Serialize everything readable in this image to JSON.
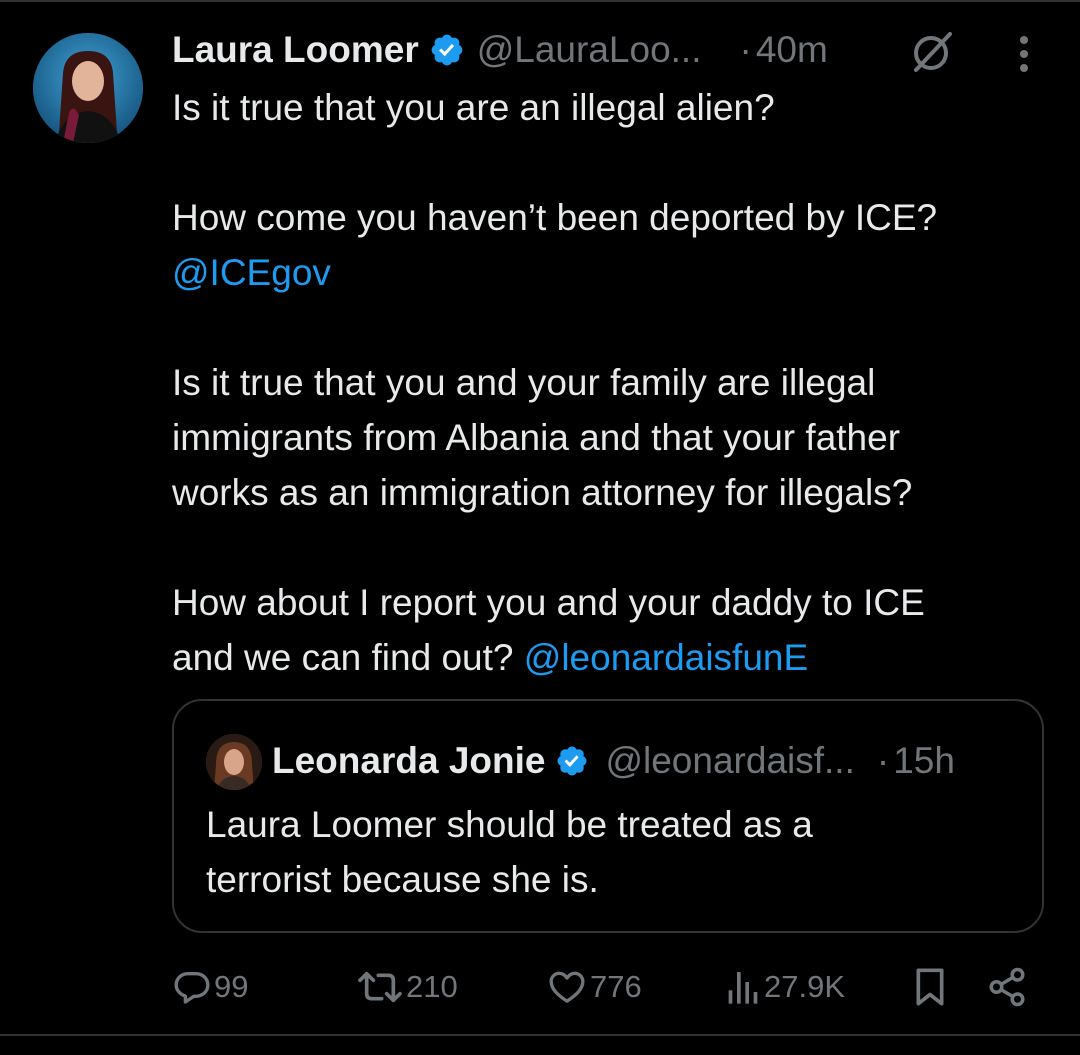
{
  "tweet": {
    "author_name": "Laura Loomer",
    "author_handle": "@LauraLoo...",
    "time_separator": "·",
    "time": "40m",
    "body": {
      "p1": "Is it true that you are an illegal alien?",
      "p2_line1": "How come you haven’t been deported by ICE?",
      "p2_mention": "@ICEgov",
      "p3_line1": "Is it true that you and your family are illegal",
      "p3_line2": "immigrants from Albania and that your father",
      "p3_line3": "works as an immigration attorney for illegals?",
      "p4_line1": "How about I report you and your daddy to ICE",
      "p4_line2": "and we can find out? ",
      "p4_mention": "@leonardaisfunE"
    }
  },
  "quote": {
    "author_name": "Leonarda Jonie",
    "author_handle": "@leonardaisf...",
    "time_separator": "·",
    "time": "15h",
    "line1": "Laura Loomer should be treated as a",
    "line2": "terrorist because she is."
  },
  "actions": {
    "replies": "99",
    "reposts": "210",
    "likes": "776",
    "views": "27.9K"
  },
  "colors": {
    "background": "#000000",
    "text": "#e7e9ea",
    "muted": "#71767b",
    "link": "#1d9bf0",
    "border": "#2f3336"
  },
  "icons": [
    "verified-badge-icon",
    "grok-icon",
    "more-options-icon",
    "reply-icon",
    "repost-icon",
    "like-icon",
    "views-icon",
    "bookmark-icon",
    "share-icon"
  ]
}
